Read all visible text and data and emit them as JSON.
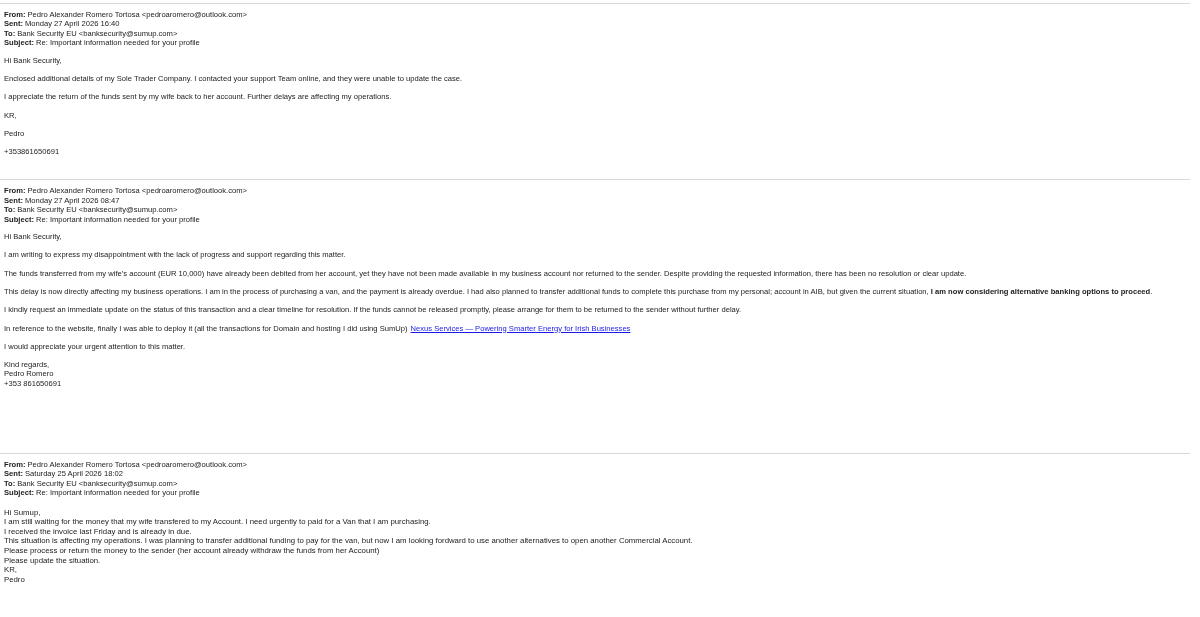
{
  "emails": [
    {
      "header": [
        {
          "label": "From:",
          "value": "Pedro Alexander Romero Tortosa <pedroaromero@outlook.com>"
        },
        {
          "label": "Sent:",
          "value": "Monday 27 April 2026 16:40"
        },
        {
          "label": "To:",
          "value": "Bank Security EU <banksecurity@sumup.com>"
        },
        {
          "label": "Subject:",
          "value": "Re: Important information needed for your profile"
        }
      ],
      "blocks": [
        [
          {
            "text": "Hi Bank Security,"
          }
        ],
        [
          {
            "text": "Enclosed additional details of my Sole Trader Company. I contacted your support Team online, and they were unable to update the case."
          }
        ],
        [
          {
            "text": "I appreciate the return of the funds sent by my wife back to her account. Further delays are affecting my operations."
          }
        ],
        [
          {
            "text": "KR,"
          }
        ],
        [
          {
            "text": "Pedro"
          }
        ],
        [
          {
            "text": "+353861650691"
          }
        ]
      ]
    },
    {
      "header": [
        {
          "label": "From:",
          "value": "Pedro Alexander Romero Tortosa <pedroaromero@outlook.com>"
        },
        {
          "label": "Sent:",
          "value": "Monday 27 April 2026 08:47"
        },
        {
          "label": "To:",
          "value": "Bank Security EU <banksecurity@sumup.com>"
        },
        {
          "label": "Subject:",
          "value": "Re: Important information needed for your profile"
        }
      ],
      "blocks": [
        [
          {
            "text": "Hi Bank Security,"
          }
        ],
        [
          {
            "text": "I am writing to express my disappointment with the lack of progress and support regarding this matter."
          }
        ],
        [
          {
            "text": "The funds transferred from my wife’s account (EUR 10,000) have already been debited from her account, yet they have not been made available in my business account nor returned to the sender. Despite providing the requested information, there has been no resolution or clear update."
          }
        ],
        [
          {
            "text": "This delay is now directly affecting my business operations. I am in the process of purchasing a van, and the payment is already overdue. I had also planned to transfer additional funds to complete this purchase from my personal; account in AIB, but given the current situation, **I am now considering alternative banking options to proceed**."
          }
        ],
        [
          {
            "text": "I kindly request an immediate update on the status of this transaction and a clear timeline for resolution. If the funds cannot be released promptly, please arrange for them to be returned to the sender without further delay."
          }
        ],
        [
          {
            "text": "In reference to the website, finally I was able to deploy it (all the transactions for Domain and hosting I did using SumUp)",
            "link": "Nexus Services — Powering Smarter Energy for Irish Businesses"
          }
        ],
        [
          {
            "text": "I would appreciate your urgent attention to this matter."
          }
        ],
        [
          {
            "text": "Kind regards,"
          },
          {
            "text": "Pedro Romero"
          },
          {
            "text": "+353 861650691"
          }
        ]
      ]
    },
    {
      "header": [
        {
          "label": "From:",
          "value": "Pedro Alexander Romero Tortosa <pedroaromero@outlook.com>"
        },
        {
          "label": "Sent:",
          "value": "Saturday 25 April 2026 18:02"
        },
        {
          "label": "To:",
          "value": "Bank Security EU <banksecurity@sumup.com>"
        },
        {
          "label": "Subject:",
          "value": "Re: Important information needed for your profile"
        }
      ],
      "blocks": [
        [
          {
            "text": "Hi Sumup,"
          },
          {
            "text": "I am still waiting for the money that my wife transfered to my Account. I need urgently to paid for a Van that I am purchasing."
          },
          {
            "text": "I received the invoice last Friday and is already in due."
          },
          {
            "text": "This situation is affecting my operations. I was planning to transfer additional funding to pay for the van, but now I am  looking fordward to use another alternatives to open another Commercial Account."
          },
          {
            "text": "Please process or return the money to the sender (her account already withdraw the funds from her Account)"
          },
          {
            "text": "Please update the situation."
          },
          {
            "text": "KR,"
          },
          {
            "text": "Pedro"
          }
        ]
      ]
    }
  ]
}
